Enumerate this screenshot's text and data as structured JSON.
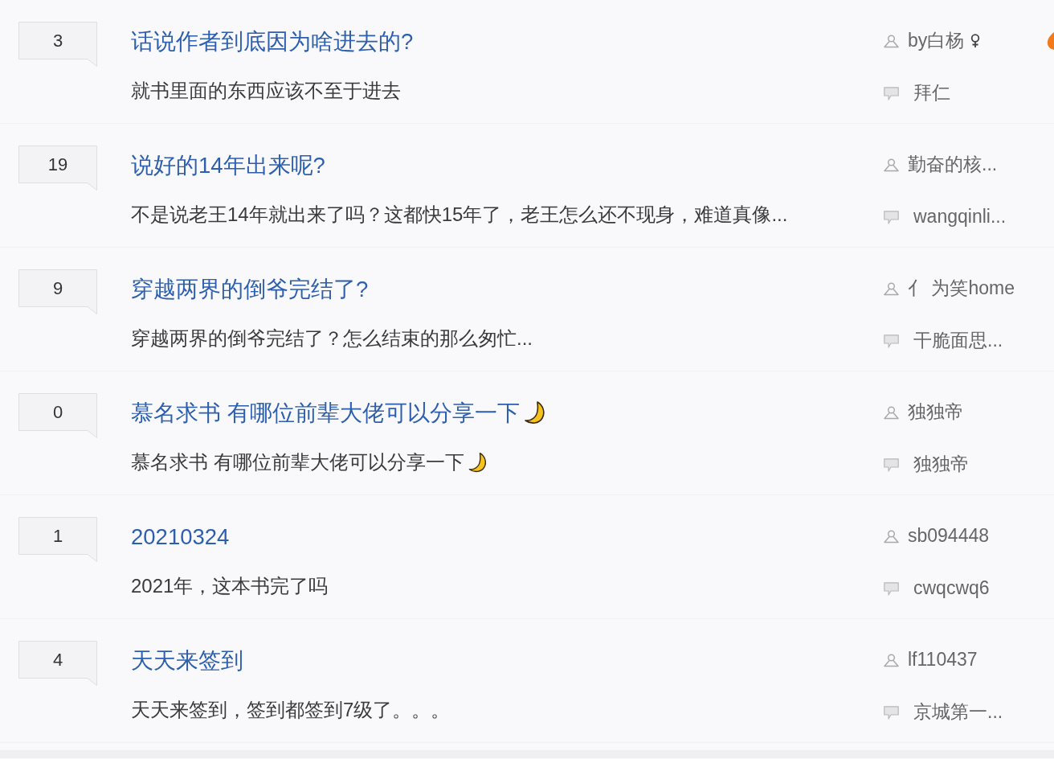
{
  "threads": [
    {
      "reply_count": "3",
      "title": "话说作者到底因为啥进去的?",
      "title_icon": false,
      "excerpt": "就书里面的东西应该不至于进去",
      "excerpt_icon": false,
      "author": "by白杨",
      "author_badge": true,
      "badge": true,
      "last_reply": "拜仁"
    },
    {
      "reply_count": "19",
      "title": "说好的14年出来呢?",
      "title_icon": false,
      "excerpt": "不是说老王14年就出来了吗？这都快15年了，老王怎么还不现身，难道真像...",
      "excerpt_icon": false,
      "author": "勤奋的核...",
      "author_badge": false,
      "badge": false,
      "last_reply": "wangqinli..."
    },
    {
      "reply_count": "9",
      "title": "穿越两界的倒爷完结了?",
      "title_icon": false,
      "excerpt": "穿越两界的倒爷完结了？怎么结束的那么匆忙...",
      "excerpt_icon": false,
      "author": "亻 为笑home",
      "author_badge": false,
      "badge": false,
      "last_reply": "干脆面思..."
    },
    {
      "reply_count": "0",
      "title": "慕名求书 有哪位前辈大佬可以分享一下",
      "title_icon": true,
      "excerpt": "慕名求书 有哪位前辈大佬可以分享一下",
      "excerpt_icon": true,
      "author": "独独帝",
      "author_badge": false,
      "badge": false,
      "last_reply": "独独帝"
    },
    {
      "reply_count": "1",
      "title": "20210324",
      "title_icon": false,
      "excerpt": "2021年，这本书完了吗",
      "excerpt_icon": false,
      "author": "sb094448",
      "author_badge": false,
      "badge": false,
      "last_reply": "cwqcwq6"
    },
    {
      "reply_count": "4",
      "title": "天天来签到",
      "title_icon": false,
      "excerpt": "天天来签到，签到都签到7级了。。。",
      "excerpt_icon": false,
      "author": "lf110437",
      "author_badge": false,
      "badge": false,
      "last_reply": "京城第一..."
    }
  ]
}
